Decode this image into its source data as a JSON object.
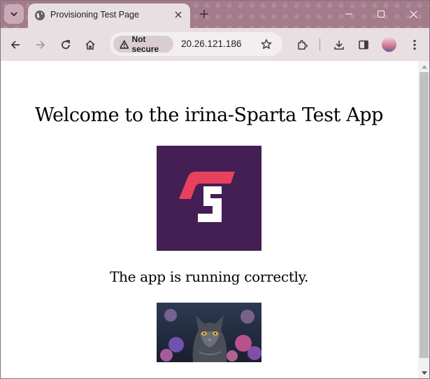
{
  "browser": {
    "tab_title": "Provisioning Test Page",
    "security_chip": "Not secure",
    "url": "20.26.121.186",
    "accent_color": "#a37b8a"
  },
  "icons": [
    "tab-search-icon",
    "globe-icon",
    "close-icon",
    "plus-icon",
    "minimize-icon",
    "maximize-icon",
    "close-window-icon",
    "back-icon",
    "forward-icon",
    "reload-icon",
    "home-icon",
    "warning-icon",
    "star-icon",
    "extensions-icon",
    "download-icon",
    "sidepanel-icon",
    "kebab-icon"
  ],
  "page": {
    "heading": "Welcome to the irina-Sparta Test App",
    "subheading": "The app is running correctly.",
    "logo_bg": "#431f53",
    "logo_accent": "#e8415f"
  }
}
